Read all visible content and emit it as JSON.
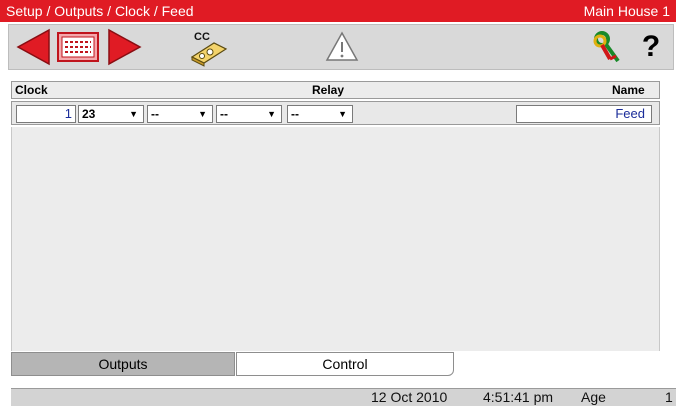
{
  "window": {
    "title": "Setup / Outputs / Clock / Feed",
    "location": "Main House 1"
  },
  "toolbar": {
    "icons": [
      "arrow-left-icon",
      "list-icon",
      "arrow-right-icon",
      "copy-cc-icon",
      "warning-icon",
      "keys-icon",
      "help-icon"
    ],
    "copy_label": "CC",
    "help_label": "?",
    "colors": {
      "arrow": "#e01b24",
      "toolbar_bg": "#d9d9d9"
    }
  },
  "grid": {
    "headers": {
      "clock": "Clock",
      "relay": "Relay",
      "name": "Name"
    },
    "rows": [
      {
        "clock": "1",
        "relays": [
          "23",
          "--",
          "--",
          "--"
        ],
        "name": "Feed"
      }
    ]
  },
  "tabs": [
    {
      "label": "Outputs",
      "active": true
    },
    {
      "label": "Control",
      "active": false
    }
  ],
  "status": {
    "date": "12 Oct 2010",
    "time": "4:51:41 pm",
    "age_label": "Age",
    "age_value": "1"
  },
  "colors": {
    "title_bg": "#e01b24",
    "value_text": "#1a2c9a"
  }
}
